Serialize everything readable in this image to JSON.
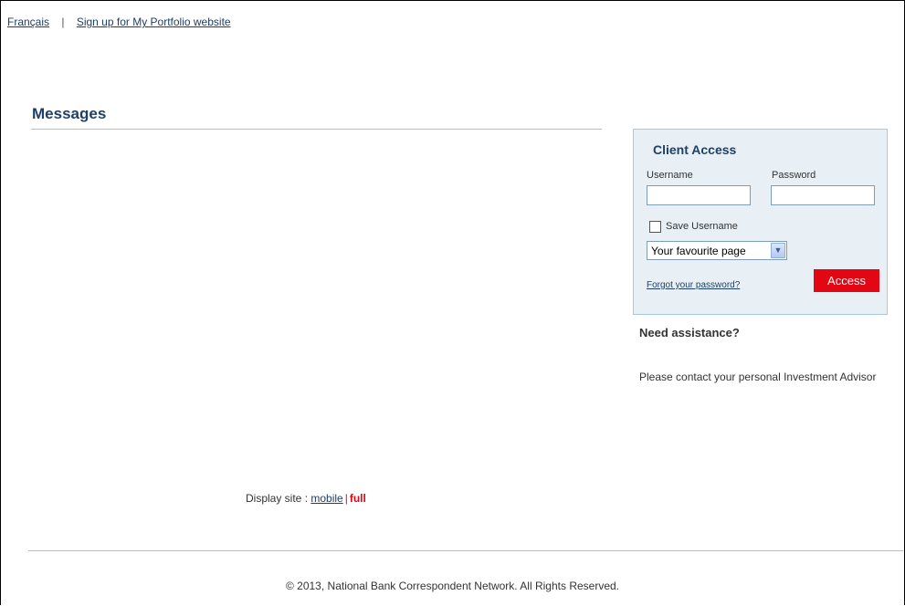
{
  "top_links": {
    "language_label": "Français",
    "separator": "|",
    "signup_label": "Sign up for My Portfolio website"
  },
  "messages": {
    "title": "Messages"
  },
  "client_access": {
    "title": "Client Access",
    "username_label": "Username",
    "username_value": "",
    "password_label": "Password",
    "password_value": "",
    "save_username_label": "Save Username",
    "save_username_checked": false,
    "page_select_value": "Your favourite page",
    "forgot_password_label": "Forgot your password?",
    "access_button_label": "Access",
    "access_button_color": "#e30613"
  },
  "assistance": {
    "title": "Need assistance?",
    "text": "Please contact your personal Investment Advisor"
  },
  "display_site": {
    "prefix": "Display site :",
    "mobile_label": "mobile",
    "separator": "|",
    "full_label": "full"
  },
  "footer": {
    "copyright": "© 2013, National Bank Correspondent Network. All Rights Reserved."
  },
  "colors": {
    "brand_blue": "#1f3f66",
    "brand_red": "#e30613",
    "panel_bg": "#e8f0f5",
    "rule": "#9ec7d1"
  }
}
